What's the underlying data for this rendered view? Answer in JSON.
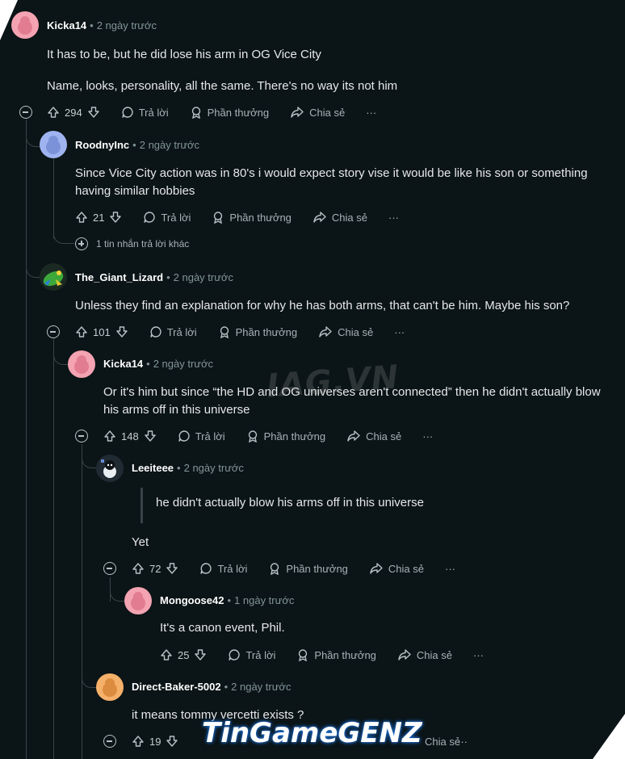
{
  "comments": [
    {
      "id": "c1",
      "user": "Kicka14",
      "time": "2 ngày trước",
      "paragraphs": [
        "It has to be, but he did lose his arm in OG Vice City",
        "Name, looks, personality, all the same. There's no way its not him"
      ],
      "votes": "294",
      "avatar": "pink-snoo"
    },
    {
      "id": "c2",
      "user": "RoodnyInc",
      "time": "2 ngày trước",
      "paragraphs": [
        "Since Vice City action was in 80's i would expect story vise it would be like his son or something having similar hobbies"
      ],
      "votes": "21",
      "avatar": "blue-snoo"
    },
    {
      "id": "c3",
      "user": "The_Giant_Lizard",
      "time": "2 ngày trước",
      "paragraphs": [
        "Unless they find an explanation for why he has both arms, that can't be him. Maybe his son?"
      ],
      "votes": "101",
      "avatar": "lizard"
    },
    {
      "id": "c4",
      "user": "Kicka14",
      "time": "2 ngày trước",
      "paragraphs": [
        "Or it's him but since “the HD and OG universes aren't connected” then he didn't actually blow his arms off in this universe"
      ],
      "votes": "148",
      "avatar": "pink-snoo"
    },
    {
      "id": "c5",
      "user": "Leeiteee",
      "time": "2 ngày trước",
      "quote": "he didn't actually blow his arms off in this universe",
      "paragraphs": [
        "Yet"
      ],
      "votes": "72",
      "avatar": "dark-snoo"
    },
    {
      "id": "c6",
      "user": "Mongoose42",
      "time": "1 ngày trước",
      "paragraphs": [
        "It's a canon event, Phil."
      ],
      "votes": "25",
      "avatar": "pink-snoo"
    },
    {
      "id": "c7",
      "user": "Direct-Baker-5002",
      "time": "2 ngày trước",
      "paragraphs": [
        "it means tommy vercetti exists ?"
      ],
      "votes": "19",
      "avatar": "orange-snoo"
    }
  ],
  "actions": {
    "reply": "Trả lời",
    "award": "Phần thưởng",
    "share": "Chia sẻ",
    "more": "···"
  },
  "more_replies": "1 tin nhắn trả lời khác",
  "watermarks": {
    "middle": "IAG.VN",
    "bottom": "TinGameGENZ"
  },
  "colors": {
    "background": "#0b1416",
    "text": "#e6e8ea",
    "muted": "#82959b",
    "pink_avatar": "#f4a3b2",
    "blue_avatar": "#9fb3f0",
    "orange_avatar": "#f5b06a",
    "watermark_glow": "#1b6dd1"
  }
}
